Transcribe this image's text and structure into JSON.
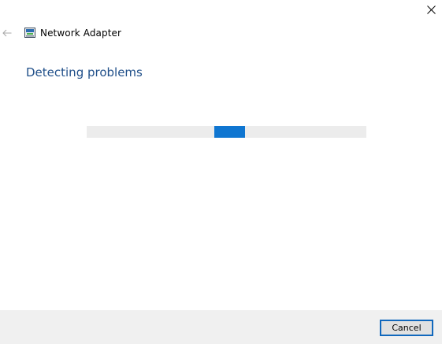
{
  "window": {
    "title": "Network Adapter",
    "title_icon": "network-adapter-icon",
    "back_icon": "back-arrow-icon",
    "close_icon": "close-icon"
  },
  "main": {
    "heading": "Detecting problems",
    "progress": {
      "indeterminate": true,
      "color": "#0F76D1",
      "track_color": "#ECECEC"
    }
  },
  "footer": {
    "cancel_label": "Cancel"
  },
  "colors": {
    "heading": "#21508A",
    "accent": "#1168BD",
    "footer_bg": "#F0F0F0"
  }
}
